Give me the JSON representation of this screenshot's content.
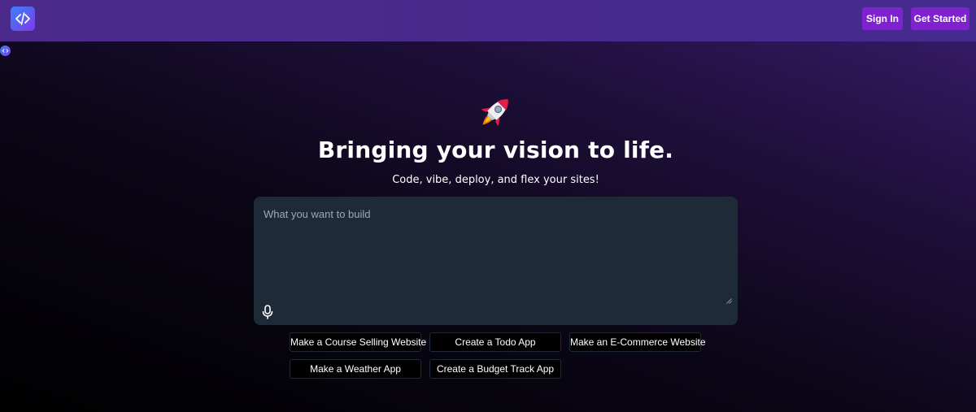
{
  "header": {
    "logo_icon": "code-brackets-icon",
    "sign_in_label": "Sign In",
    "get_started_label": "Get Started",
    "accent_color": "#7e22ce"
  },
  "hero": {
    "icon": "rocket-icon",
    "title": "Bringing your vision to life.",
    "subtitle": "Code, vibe, deploy, and flex your sites!"
  },
  "prompt": {
    "placeholder": "What you want to build",
    "value": "",
    "mic_icon": "microphone-icon"
  },
  "suggestions": [
    "Make a Course Selling Website",
    "Create a Todo App",
    "Make an E-Commerce Website",
    "Make a Weather App",
    "Create a Budget Track App"
  ]
}
